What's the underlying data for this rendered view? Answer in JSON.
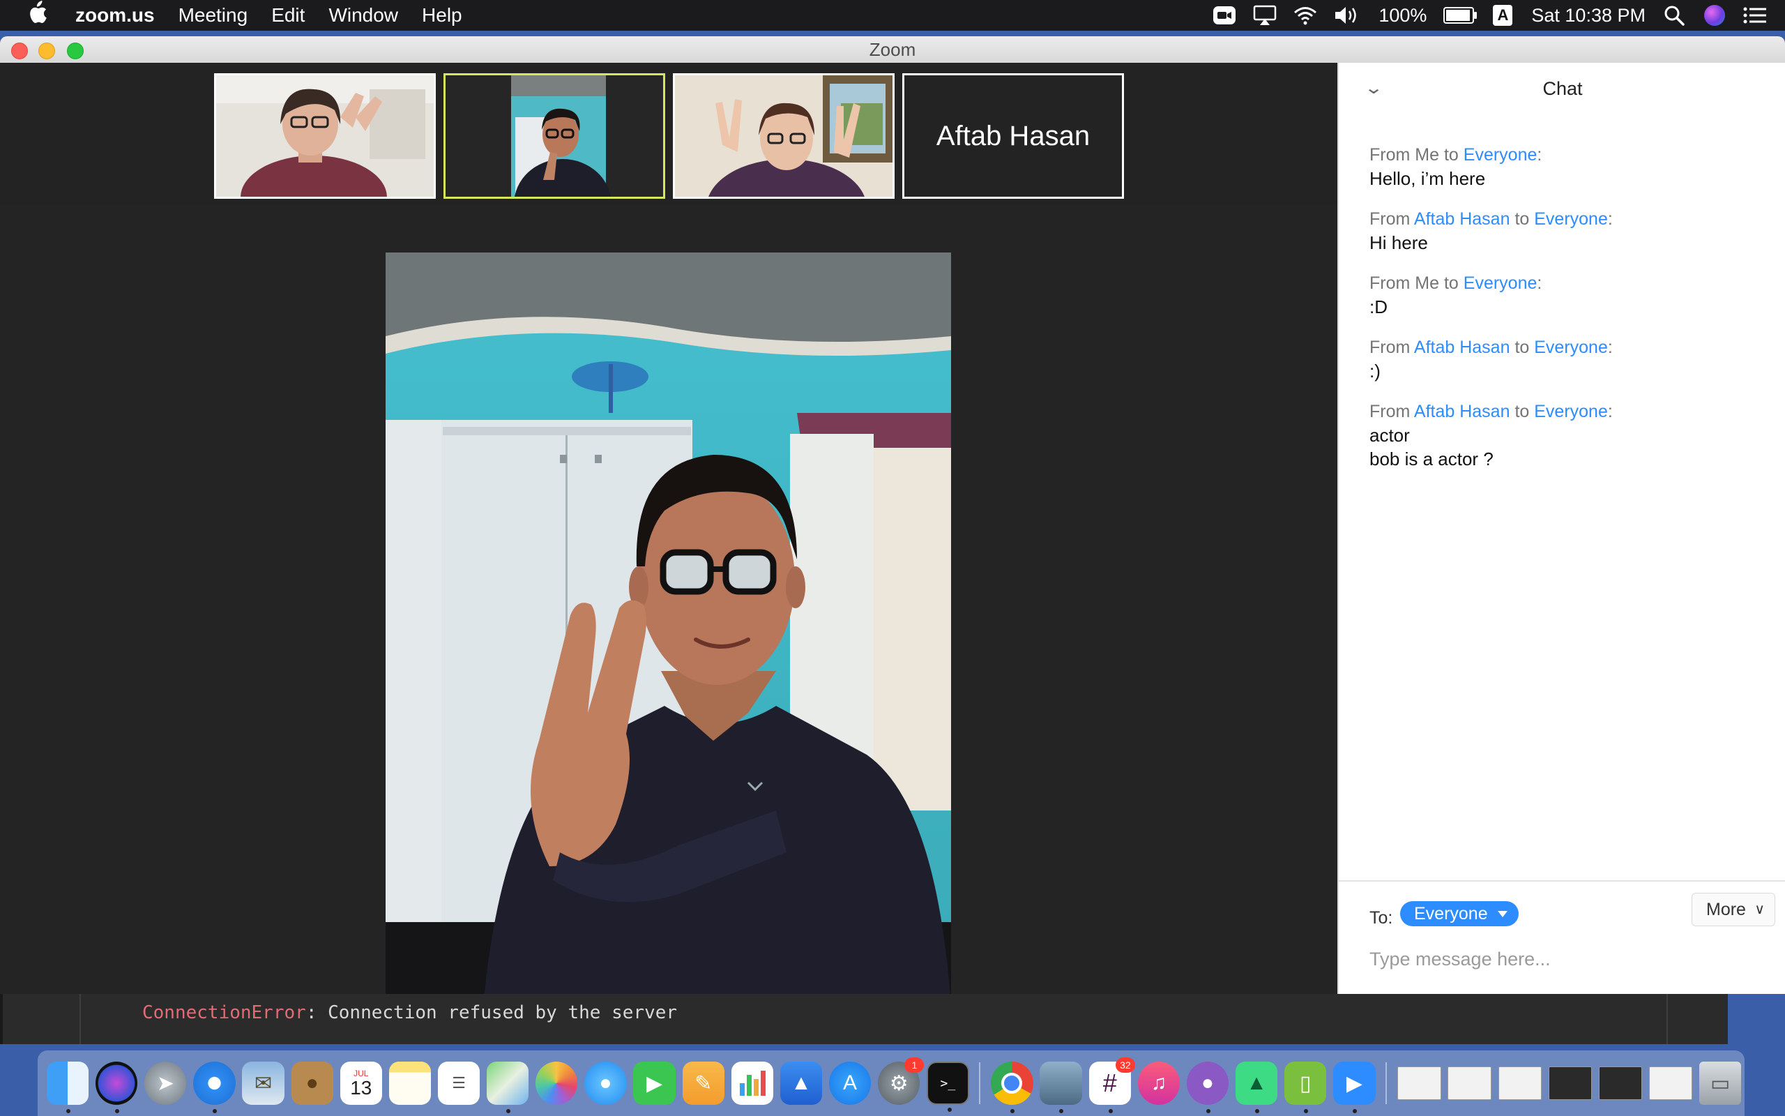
{
  "menubar": {
    "app": "zoom.us",
    "items": [
      "Meeting",
      "Edit",
      "Window",
      "Help"
    ],
    "battery": "100%",
    "input_source": "A",
    "clock": "Sat 10:38 PM",
    "icons": [
      "zoom-status-icon",
      "airplay-icon",
      "wifi-icon",
      "volume-icon",
      "battery-charging-icon",
      "spotlight-icon",
      "siri-icon",
      "notification-center-icon"
    ]
  },
  "window": {
    "title": "Zoom"
  },
  "participants": {
    "thumbnails": [
      {
        "kind": "video"
      },
      {
        "kind": "video",
        "active": true
      },
      {
        "kind": "video"
      },
      {
        "kind": "name",
        "name": "Aftab Hasan"
      }
    ]
  },
  "chat": {
    "title": "Chat",
    "messages": [
      {
        "from": "Me",
        "to": "Everyone",
        "lines": [
          "Hello, i’m here"
        ]
      },
      {
        "from": "Aftab Hasan",
        "to": "Everyone",
        "lines": [
          "Hi here"
        ]
      },
      {
        "from": "Me",
        "to": "Everyone",
        "lines": [
          ":D"
        ]
      },
      {
        "from": "Aftab Hasan",
        "to": "Everyone",
        "lines": [
          ":)"
        ]
      },
      {
        "from": "Aftab Hasan",
        "to": "Everyone",
        "lines": [
          "actor",
          "bob is a actor ?"
        ]
      }
    ],
    "labels": {
      "from_word": "From ",
      "to_word": " to ",
      "colon": ":"
    },
    "to_label": "To:",
    "recipient": "Everyone",
    "more_label": "More",
    "input_placeholder": "Type message here..."
  },
  "terminal": {
    "error_name": "ConnectionError",
    "error_message": ": Connection refused by the server"
  },
  "dock": {
    "calendar_month": "JUL",
    "calendar_day": "13",
    "badges": {
      "system-preferences": "1",
      "slack": "32"
    },
    "terminal_prompt": ">_"
  },
  "colors": {
    "accent_blue": "#2d8cff",
    "active_speaker_border": "#d6e85a",
    "error_red": "#e06c75"
  }
}
